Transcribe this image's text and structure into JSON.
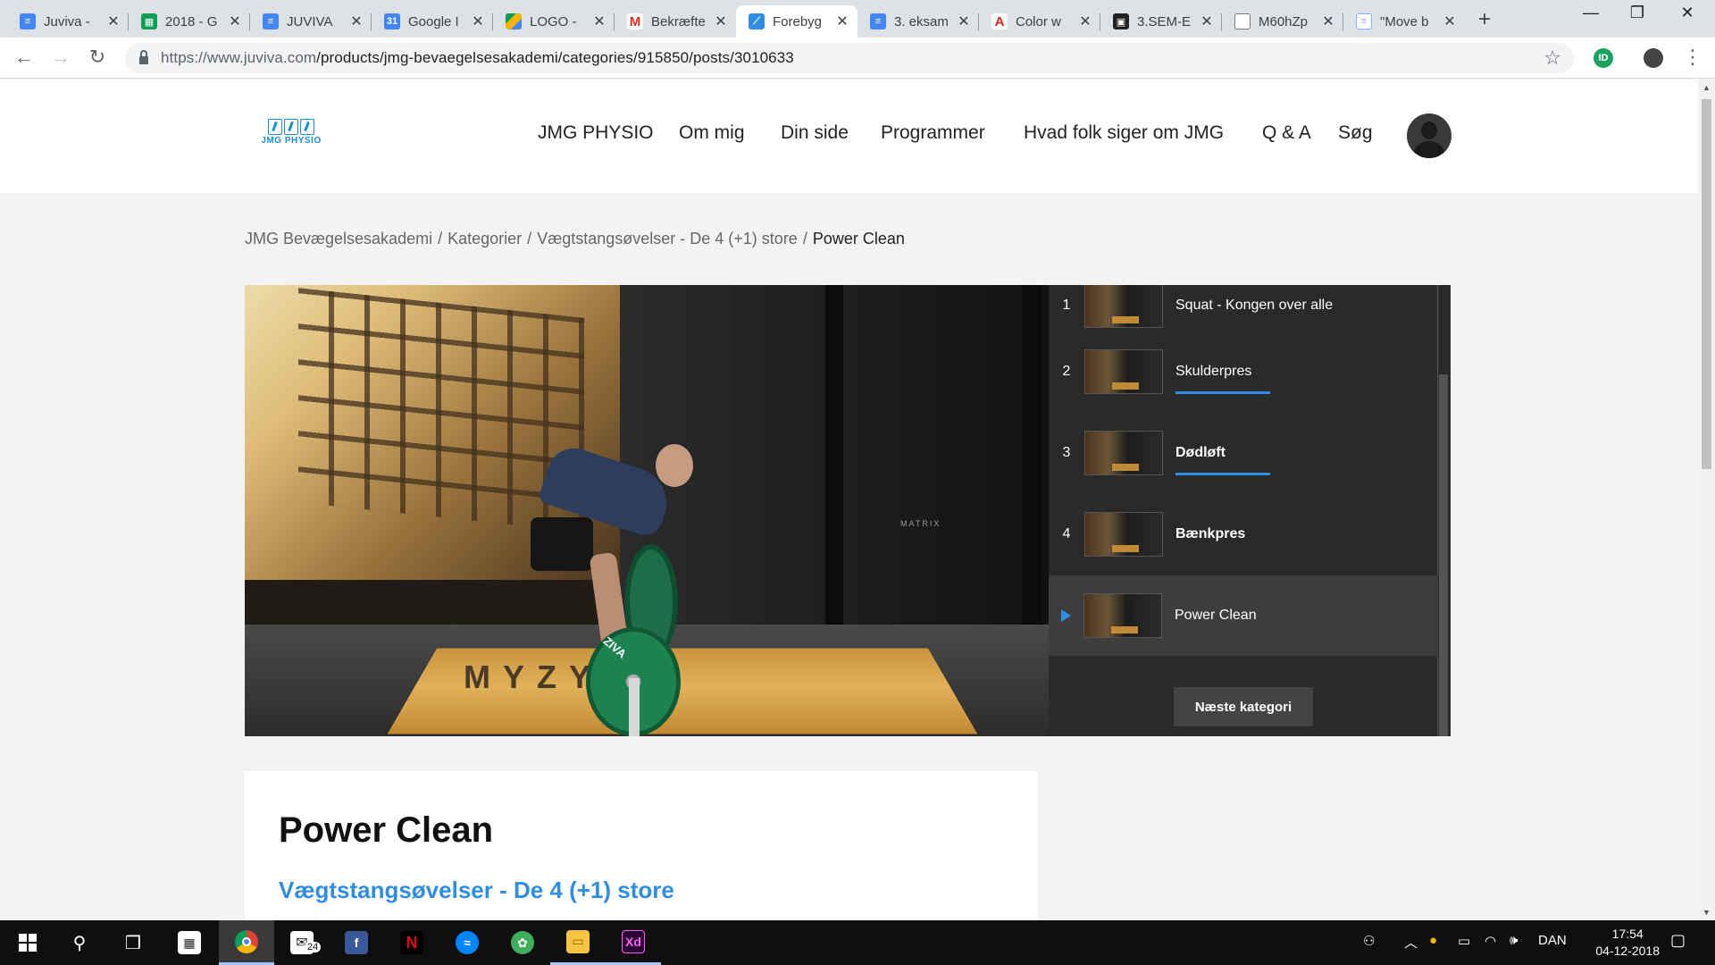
{
  "browser": {
    "tabs": [
      {
        "title": "Juviva -",
        "icon": "google-docs-icon",
        "color": "#4285f4"
      },
      {
        "title": "2018 - G",
        "icon": "google-sheets-icon",
        "color": "#0f9d58"
      },
      {
        "title": "JUVIVA",
        "icon": "google-docs-icon",
        "color": "#4285f4"
      },
      {
        "title": "Google I",
        "icon": "google-calendar-icon",
        "color": "#4285f4"
      },
      {
        "title": "LOGO -",
        "icon": "google-drive-icon",
        "color": "#f4b400"
      },
      {
        "title": "Bekræfte",
        "icon": "gmail-icon",
        "color": "#d93025"
      },
      {
        "title": "Forebyg",
        "icon": "juviva-icon",
        "color": "#2f8de4",
        "active": true
      },
      {
        "title": "3. eksam",
        "icon": "google-docs-icon",
        "color": "#4285f4"
      },
      {
        "title": "Color w",
        "icon": "adobe-icon",
        "color": "#e1251b"
      },
      {
        "title": "3.SEM-E",
        "icon": "canvas-icon",
        "color": "#222222"
      },
      {
        "title": "M60hZp",
        "icon": "file-icon",
        "color": "#777777"
      },
      {
        "title": "\"Move b",
        "icon": "doc-icon",
        "color": "#8ab4f8"
      }
    ],
    "url_host": "https://www.juviva.com",
    "url_path": "/products/jmg-bevaegelsesakademi/categories/915850/posts/3010633",
    "new_tab_label": "+"
  },
  "site": {
    "logo_text": "JMG PHYSIO",
    "nav": [
      "JMG PHYSIO",
      "Om mig",
      "Din side",
      "Programmer",
      "Hvad folk siger om JMG",
      "Q & A",
      "Søg"
    ],
    "breadcrumb": [
      "JMG Bevægelsesakademi",
      "Kategorier",
      "Vægtstangsøvelser - De 4 (+1) store"
    ],
    "breadcrumb_current": "Power Clean",
    "breadcrumb_separator": "/"
  },
  "playlist": {
    "items": [
      {
        "num": "1",
        "title": "Squat - Kongen over alle",
        "bold": false,
        "progress": false
      },
      {
        "num": "2",
        "title": "Skulderpres",
        "bold": false,
        "progress": true
      },
      {
        "num": "3",
        "title": "Dødløft",
        "bold": true,
        "progress": true
      },
      {
        "num": "4",
        "title": "Bænkpres",
        "bold": true,
        "progress": false
      },
      {
        "num": "",
        "title": "Power Clean",
        "bold": false,
        "progress": false,
        "active": true
      }
    ],
    "next_label": "Næste kategori",
    "accent": "#2f8de4"
  },
  "video": {
    "platform_text": "MYZYM",
    "plate_text": "ZIVA",
    "rack_text": "MATRIX"
  },
  "post": {
    "title": "Power Clean",
    "category": "Vægtstangsøvelser - De 4 (+1) store"
  },
  "taskbar": {
    "mail_badge": "24",
    "language": "DAN",
    "time": "17:54",
    "date": "04-12-2018"
  }
}
